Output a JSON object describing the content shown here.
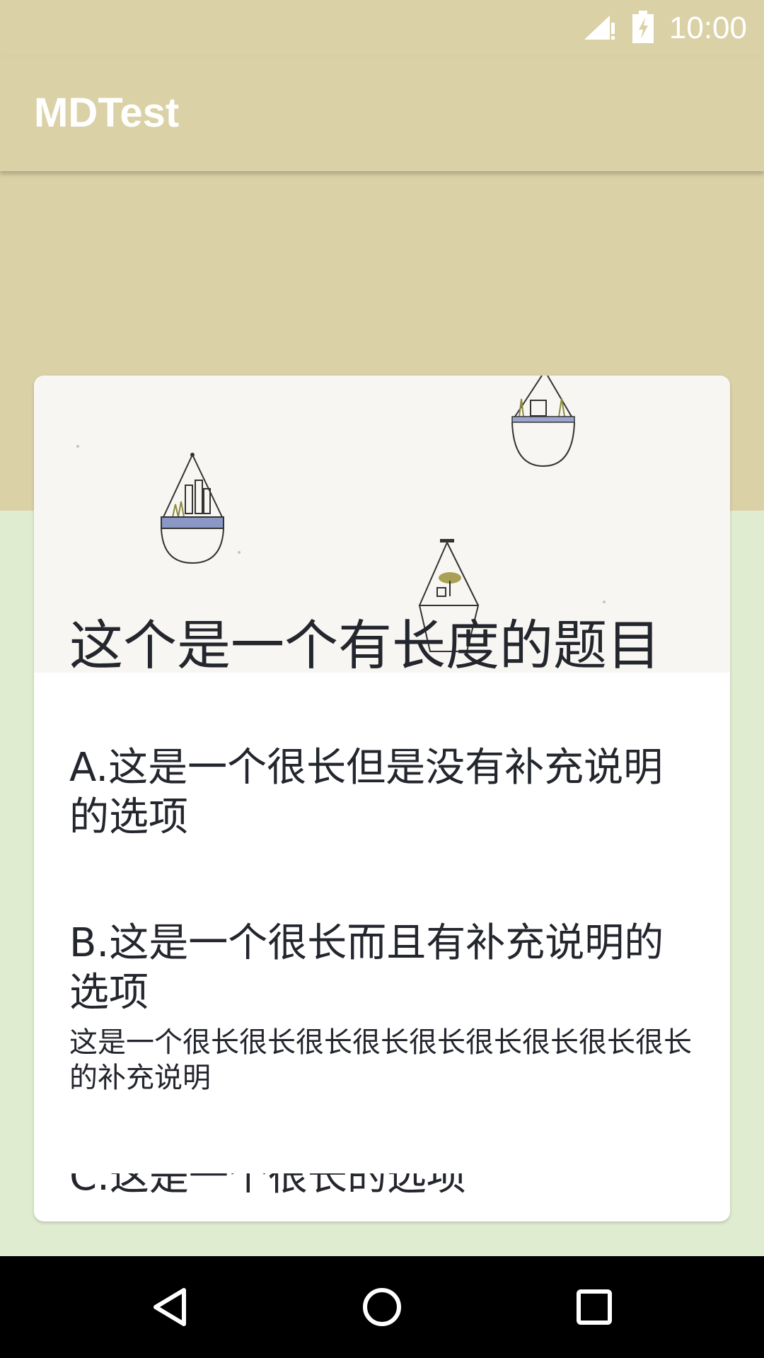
{
  "status_bar": {
    "time": "10:00",
    "icons": [
      "signal-no-data-icon",
      "battery-charging-icon"
    ]
  },
  "app_bar": {
    "title": "MDTest"
  },
  "card": {
    "title": "这个是一个有长度的题目",
    "options": [
      {
        "text": "A.这是一个很长但是没有补充说明的选项",
        "description": ""
      },
      {
        "text": "B.这是一个很长而且有补充说明的选项",
        "description": "这是一个很长很长很长很长很长很长很长很长很长的补充说明"
      },
      {
        "text": "C.这是一个很长的选项",
        "description": ""
      }
    ]
  },
  "nav_bar": {
    "buttons": [
      "back-icon",
      "home-icon",
      "recents-icon"
    ]
  },
  "colors": {
    "primary": "#dbd1a7",
    "background": "#e0ecd0",
    "card": "#ffffff",
    "text": "#24262e"
  }
}
